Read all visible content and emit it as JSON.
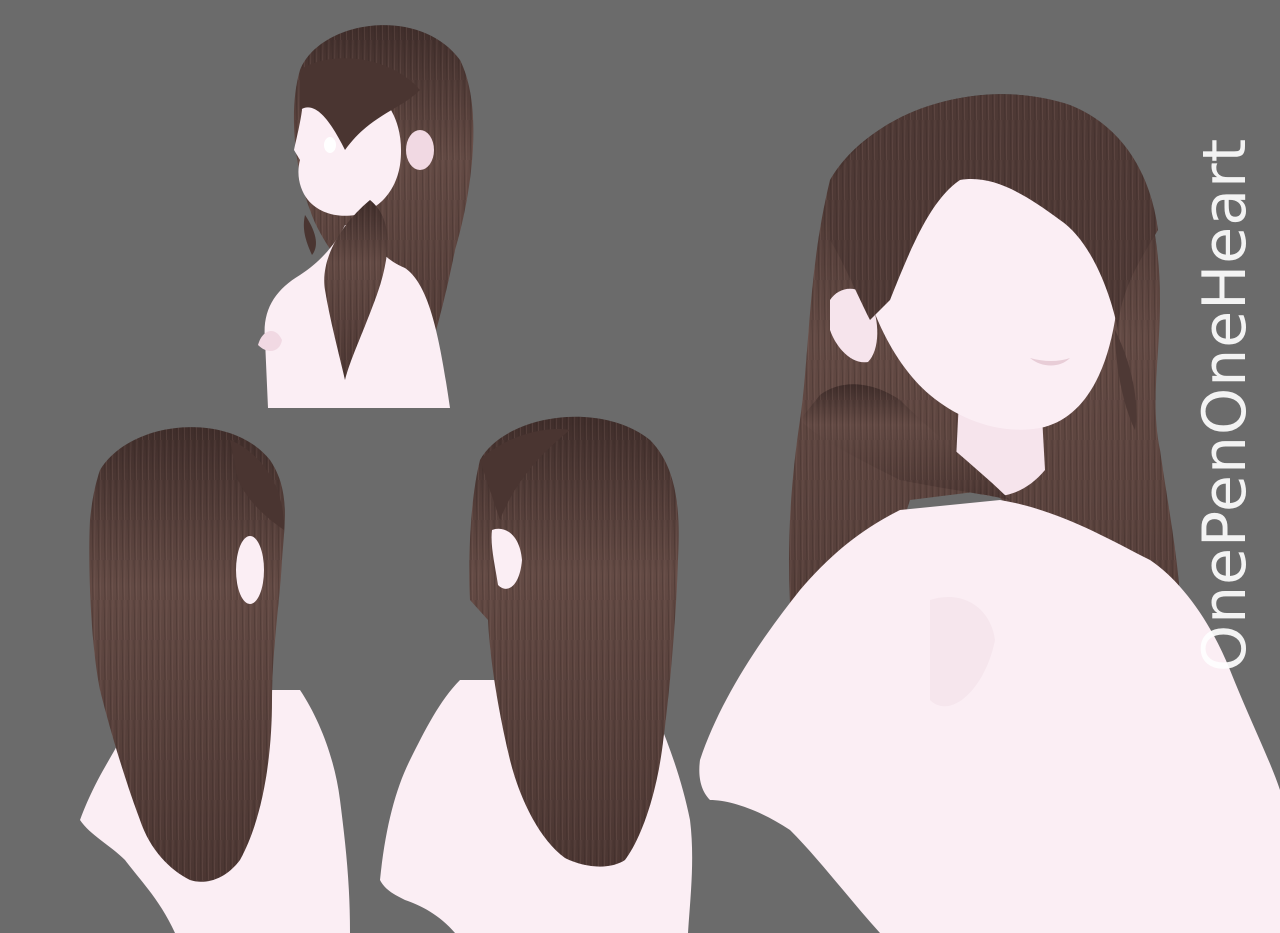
{
  "watermark": {
    "text": "OnePenOneHeart"
  },
  "colors": {
    "background": "#6b6b6b",
    "skin": "#fbeef4",
    "skin_shadow": "#f1d9e3",
    "hair": "#5e4741",
    "hair_dark": "#3c2b28",
    "hair_light": "#7a605a"
  },
  "views": [
    "hair-side-view",
    "hair-back-view",
    "hair-back-three-quarter-view",
    "hair-front-three-quarter-view"
  ]
}
